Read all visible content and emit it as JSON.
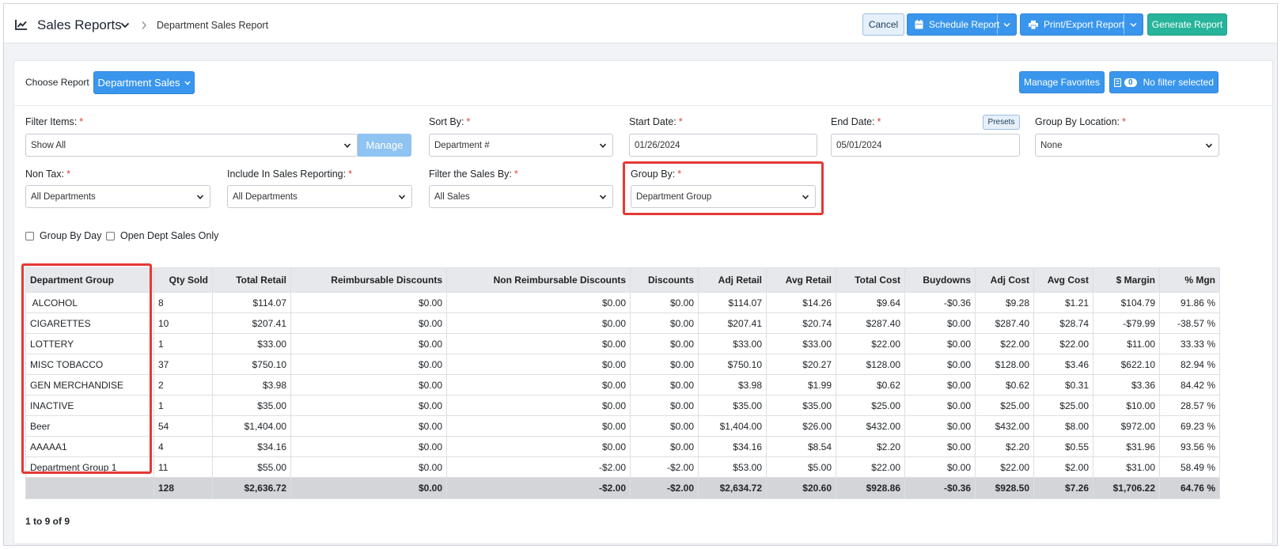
{
  "header": {
    "title": "Sales Reports",
    "breadcrumb": "Department Sales Report",
    "cancel_label": "Cancel",
    "schedule_label": "Schedule Report",
    "print_label": "Print/Export Report",
    "generate_label": "Generate Report"
  },
  "report": {
    "choose_label": "Choose Report",
    "selected": "Department Sales",
    "manage_favorites": "Manage Favorites",
    "filter_count": "0",
    "filter_status": "No filter selected"
  },
  "filters": {
    "filter_items": {
      "label": "Filter Items:",
      "value": "Show All",
      "manage": "Manage"
    },
    "sort_by": {
      "label": "Sort By:",
      "value": "Department #"
    },
    "start_date": {
      "label": "Start Date:",
      "value": "01/26/2024"
    },
    "end_date": {
      "label": "End Date:",
      "value": "05/01/2024",
      "presets": "Presets"
    },
    "group_by_location": {
      "label": "Group By Location:",
      "value": "None"
    },
    "non_tax": {
      "label": "Non Tax:",
      "value": "All Departments"
    },
    "include_in_sales": {
      "label": "Include In Sales Reporting:",
      "value": "All Departments"
    },
    "filter_sales_by": {
      "label": "Filter the Sales By:",
      "value": "All Sales"
    },
    "group_by": {
      "label": "Group By:",
      "value": "Department Group"
    },
    "required_mark": "*"
  },
  "options": {
    "group_by_day": "Group By Day",
    "open_dept_sales_only": "Open Dept Sales Only"
  },
  "table": {
    "headers": [
      "Department Group",
      "Qty Sold",
      "Total Retail",
      "Reimbursable Discounts",
      "Non Reimbursable Discounts",
      "Discounts",
      "Adj Retail",
      "Avg Retail",
      "Total Cost",
      "Buydowns",
      "Adj Cost",
      "Avg Cost",
      "$ Margin",
      "% Mgn"
    ],
    "rows": [
      [
        " ALCOHOL",
        "8",
        "$114.07",
        "$0.00",
        "$0.00",
        "$0.00",
        "$114.07",
        "$14.26",
        "$9.64",
        "-$0.36",
        "$9.28",
        "$1.21",
        "$104.79",
        "91.86 %"
      ],
      [
        "CIGARETTES",
        "10",
        "$207.41",
        "$0.00",
        "$0.00",
        "$0.00",
        "$207.41",
        "$20.74",
        "$287.40",
        "$0.00",
        "$287.40",
        "$28.74",
        "-$79.99",
        "-38.57 %"
      ],
      [
        "LOTTERY",
        "1",
        "$33.00",
        "$0.00",
        "$0.00",
        "$0.00",
        "$33.00",
        "$33.00",
        "$22.00",
        "$0.00",
        "$22.00",
        "$22.00",
        "$11.00",
        "33.33 %"
      ],
      [
        "MISC TOBACCO",
        "37",
        "$750.10",
        "$0.00",
        "$0.00",
        "$0.00",
        "$750.10",
        "$20.27",
        "$128.00",
        "$0.00",
        "$128.00",
        "$3.46",
        "$622.10",
        "82.94 %"
      ],
      [
        "GEN MERCHANDISE",
        "2",
        "$3.98",
        "$0.00",
        "$0.00",
        "$0.00",
        "$3.98",
        "$1.99",
        "$0.62",
        "$0.00",
        "$0.62",
        "$0.31",
        "$3.36",
        "84.42 %"
      ],
      [
        "INACTIVE",
        "1",
        "$35.00",
        "$0.00",
        "$0.00",
        "$0.00",
        "$35.00",
        "$35.00",
        "$25.00",
        "$0.00",
        "$25.00",
        "$25.00",
        "$10.00",
        "28.57 %"
      ],
      [
        "Beer",
        "54",
        "$1,404.00",
        "$0.00",
        "$0.00",
        "$0.00",
        "$1,404.00",
        "$26.00",
        "$432.00",
        "$0.00",
        "$432.00",
        "$8.00",
        "$972.00",
        "69.23 %"
      ],
      [
        "AAAAA1",
        "4",
        "$34.16",
        "$0.00",
        "$0.00",
        "$0.00",
        "$34.16",
        "$8.54",
        "$2.20",
        "$0.00",
        "$2.20",
        "$0.55",
        "$31.96",
        "93.56 %"
      ],
      [
        "Department Group 1",
        "11",
        "$55.00",
        "$0.00",
        "-$2.00",
        "-$2.00",
        "$53.00",
        "$5.00",
        "$22.00",
        "$0.00",
        "$22.00",
        "$2.00",
        "$31.00",
        "58.49 %"
      ]
    ],
    "totals": [
      "",
      "128",
      "$2,636.72",
      "$0.00",
      "-$2.00",
      "-$2.00",
      "$2,634.72",
      "$20.60",
      "$928.86",
      "-$0.36",
      "$928.50",
      "$7.26",
      "$1,706.22",
      "64.76 %"
    ],
    "count_text": "1 to 9 of 9"
  },
  "colors": {
    "primary": "#3a96ec",
    "success": "#26b49a",
    "highlight": "#e53935"
  },
  "icons": [
    "chart-line-icon",
    "chevron-down-icon",
    "chevron-right-icon",
    "calendar-icon",
    "printer-icon",
    "filter-icon"
  ]
}
